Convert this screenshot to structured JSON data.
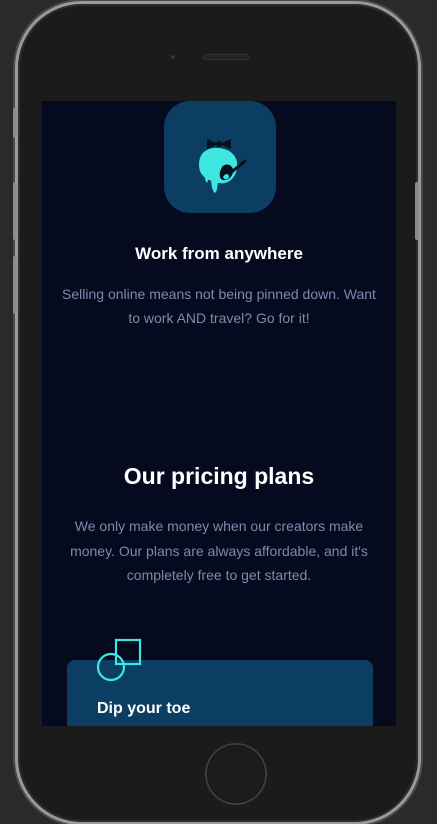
{
  "feature": {
    "icon": "toucan-brush-app-icon",
    "title": "Work from anywhere",
    "description": "Selling online means not being pinned down. Want to work AND travel? Go for it!"
  },
  "pricing": {
    "title": "Our pricing plans",
    "description": "We only make money when our creators make money. Our plans are always affordable, and it's completely free to get started."
  },
  "plans": [
    {
      "name": "Dip your toe",
      "icon": "overlapping-shapes-icon"
    }
  ],
  "colors": {
    "screen_bg": "#050a1f",
    "card_bg": "#0c3d63",
    "accent": "#3ee6e0",
    "muted_text": "#7f89ad",
    "heading_text": "#ffffff"
  }
}
